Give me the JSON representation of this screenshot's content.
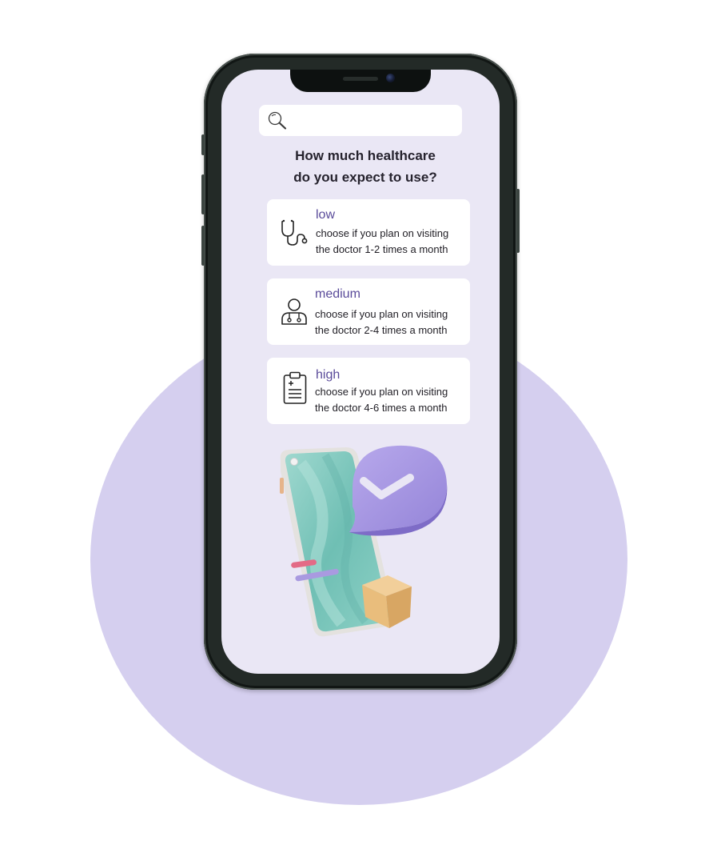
{
  "search": {
    "placeholder": "",
    "icon": "magnifier-icon"
  },
  "question": {
    "line1": "How much healthcare",
    "line2": "do you expect to use?"
  },
  "options": [
    {
      "title": "low",
      "desc_line1": "choose if you plan on visiting",
      "desc_line2": "the doctor 1-2 times a month",
      "icon": "stethoscope-icon"
    },
    {
      "title": "medium",
      "desc_line1": "choose if you plan on visiting",
      "desc_line2": "the doctor 2-4 times a month",
      "icon": "doctor-icon"
    },
    {
      "title": "high",
      "desc_line1": "choose if you plan on visiting",
      "desc_line2": "the doctor 4-6 times a month",
      "icon": "clipboard-icon"
    }
  ],
  "colors": {
    "background_circle": "#d5cfef",
    "screen_background": "#eae7f5",
    "accent_title": "#5a4b9a",
    "text_dark": "#26232e"
  }
}
